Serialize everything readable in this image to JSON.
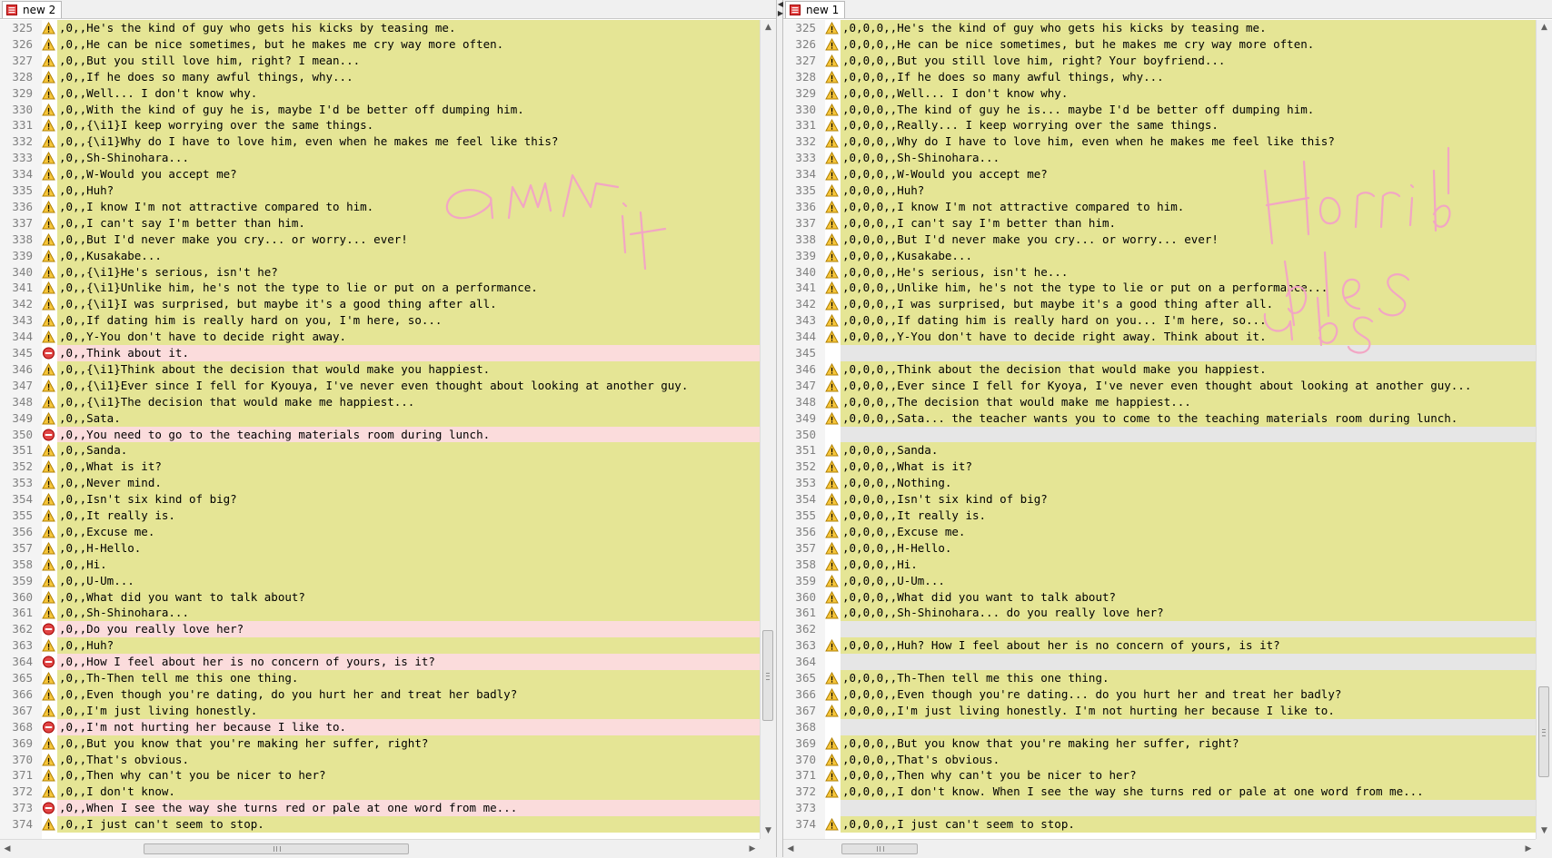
{
  "colors": {
    "warn_line_bg": "#e5e595",
    "deleted_line_bg": "#fbdcdc",
    "empty_line_bg": "#e6e6e6",
    "scribble_pink": "#f2a6c4"
  },
  "icons": {
    "warning": "warning-triangle-icon",
    "deleted": "removed-circle-icon",
    "tab": "notepad-file-icon"
  },
  "scribbles": {
    "left": "am it",
    "right": "Horri bles ubs"
  },
  "left": {
    "tab_label": "new 2",
    "lines": [
      {
        "n": "325",
        "t": ",0,,He's the kind of guy who gets his kicks by teasing me.",
        "s": "warn"
      },
      {
        "n": "326",
        "t": ",0,,He can be nice sometimes, but he makes me cry way more often.",
        "s": "warn"
      },
      {
        "n": "327",
        "t": ",0,,But you still love him, right? I mean...",
        "s": "warn"
      },
      {
        "n": "328",
        "t": ",0,,If he does so many awful things, why...",
        "s": "warn"
      },
      {
        "n": "329",
        "t": ",0,,Well... I don't know why.",
        "s": "warn"
      },
      {
        "n": "330",
        "t": ",0,,With the kind of guy he is, maybe I'd be better off dumping him.",
        "s": "warn"
      },
      {
        "n": "331",
        "t": ",0,,{\\i1}I keep worrying over the same things.",
        "s": "warn"
      },
      {
        "n": "332",
        "t": ",0,,{\\i1}Why do I have to love him, even when he makes me feel like this?",
        "s": "warn"
      },
      {
        "n": "333",
        "t": ",0,,Sh-Shinohara...",
        "s": "warn"
      },
      {
        "n": "334",
        "t": ",0,,W-Would you accept me?",
        "s": "warn"
      },
      {
        "n": "335",
        "t": ",0,,Huh?",
        "s": "warn"
      },
      {
        "n": "336",
        "t": ",0,,I know I'm not attractive compared to him.",
        "s": "warn"
      },
      {
        "n": "337",
        "t": ",0,,I can't say I'm better than him.",
        "s": "warn"
      },
      {
        "n": "338",
        "t": ",0,,But I'd never make you cry... or worry... ever!",
        "s": "warn"
      },
      {
        "n": "339",
        "t": ",0,,Kusakabe...",
        "s": "warn"
      },
      {
        "n": "340",
        "t": ",0,,{\\i1}He's serious, isn't he?",
        "s": "warn"
      },
      {
        "n": "341",
        "t": ",0,,{\\i1}Unlike him, he's not the type to lie or put on a performance.",
        "s": "warn"
      },
      {
        "n": "342",
        "t": ",0,,{\\i1}I was surprised, but maybe it's a good thing after all.",
        "s": "warn"
      },
      {
        "n": "343",
        "t": ",0,,If dating him is really hard on you, I'm here, so...",
        "s": "warn"
      },
      {
        "n": "344",
        "t": ",0,,Y-You don't have to decide right away.",
        "s": "warn"
      },
      {
        "n": "345",
        "t": ",0,,Think about it.",
        "s": "del"
      },
      {
        "n": "346",
        "t": ",0,,{\\i1}Think about the decision that would make you happiest.",
        "s": "warn"
      },
      {
        "n": "347",
        "t": ",0,,{\\i1}Ever since I fell for Kyouya, I've never even thought about looking at another guy.",
        "s": "warn"
      },
      {
        "n": "348",
        "t": ",0,,{\\i1}The decision that would make me happiest...",
        "s": "warn"
      },
      {
        "n": "349",
        "t": ",0,,Sata.",
        "s": "warn"
      },
      {
        "n": "350",
        "t": ",0,,You need to go to the teaching materials room during lunch.",
        "s": "del"
      },
      {
        "n": "351",
        "t": ",0,,Sanda.",
        "s": "warn"
      },
      {
        "n": "352",
        "t": ",0,,What is it?",
        "s": "warn"
      },
      {
        "n": "353",
        "t": ",0,,Never mind.",
        "s": "warn"
      },
      {
        "n": "354",
        "t": ",0,,Isn't six kind of big?",
        "s": "warn"
      },
      {
        "n": "355",
        "t": ",0,,It really is.",
        "s": "warn"
      },
      {
        "n": "356",
        "t": ",0,,Excuse me.",
        "s": "warn"
      },
      {
        "n": "357",
        "t": ",0,,H-Hello.",
        "s": "warn"
      },
      {
        "n": "358",
        "t": ",0,,Hi.",
        "s": "warn"
      },
      {
        "n": "359",
        "t": ",0,,U-Um...",
        "s": "warn"
      },
      {
        "n": "360",
        "t": ",0,,What did you want to talk about?",
        "s": "warn"
      },
      {
        "n": "361",
        "t": ",0,,Sh-Shinohara...",
        "s": "warn"
      },
      {
        "n": "362",
        "t": ",0,,Do you really love her?",
        "s": "del"
      },
      {
        "n": "363",
        "t": ",0,,Huh?",
        "s": "warn"
      },
      {
        "n": "364",
        "t": ",0,,How I feel about her is no concern of yours, is it?",
        "s": "del"
      },
      {
        "n": "365",
        "t": ",0,,Th-Then tell me this one thing.",
        "s": "warn"
      },
      {
        "n": "366",
        "t": ",0,,Even though you're dating, do you hurt her and treat her badly?",
        "s": "warn"
      },
      {
        "n": "367",
        "t": ",0,,I'm just living honestly.",
        "s": "warn"
      },
      {
        "n": "368",
        "t": ",0,,I'm not hurting her because I like to.",
        "s": "del"
      },
      {
        "n": "369",
        "t": ",0,,But you know that you're making her suffer, right?",
        "s": "warn"
      },
      {
        "n": "370",
        "t": ",0,,That's obvious.",
        "s": "warn"
      },
      {
        "n": "371",
        "t": ",0,,Then why can't you be nicer to her?",
        "s": "warn"
      },
      {
        "n": "372",
        "t": ",0,,I don't know.",
        "s": "warn"
      },
      {
        "n": "373",
        "t": ",0,,When I see the way she turns red or pale at one word from me...",
        "s": "del"
      },
      {
        "n": "374",
        "t": ",0,,I just can't seem to stop.",
        "s": "warn"
      }
    ]
  },
  "right": {
    "tab_label": "new 1",
    "lines": [
      {
        "n": "325",
        "t": ",0,0,0,,He's the kind of guy who gets his kicks by teasing me.",
        "s": "warn"
      },
      {
        "n": "326",
        "t": ",0,0,0,,He can be nice sometimes, but he makes me cry way more often.",
        "s": "warn"
      },
      {
        "n": "327",
        "t": ",0,0,0,,But you still love him, right? Your boyfriend...",
        "s": "warn"
      },
      {
        "n": "328",
        "t": ",0,0,0,,If he does so many awful things, why...",
        "s": "warn"
      },
      {
        "n": "329",
        "t": ",0,0,0,,Well... I don't know why.",
        "s": "warn"
      },
      {
        "n": "330",
        "t": ",0,0,0,,The kind of guy he is... maybe I'd be better off dumping him.",
        "s": "warn"
      },
      {
        "n": "331",
        "t": ",0,0,0,,Really... I keep worrying over the same things.",
        "s": "warn"
      },
      {
        "n": "332",
        "t": ",0,0,0,,Why do I have to love him, even when he makes me feel like this?",
        "s": "warn"
      },
      {
        "n": "333",
        "t": ",0,0,0,,Sh-Shinohara...",
        "s": "warn"
      },
      {
        "n": "334",
        "t": ",0,0,0,,W-Would you accept me?",
        "s": "warn"
      },
      {
        "n": "335",
        "t": ",0,0,0,,Huh?",
        "s": "warn"
      },
      {
        "n": "336",
        "t": ",0,0,0,,I know I'm not attractive compared to him.",
        "s": "warn"
      },
      {
        "n": "337",
        "t": ",0,0,0,,I can't say I'm better than him.",
        "s": "warn"
      },
      {
        "n": "338",
        "t": ",0,0,0,,But I'd never make you cry... or worry... ever!",
        "s": "warn"
      },
      {
        "n": "339",
        "t": ",0,0,0,,Kusakabe...",
        "s": "warn"
      },
      {
        "n": "340",
        "t": ",0,0,0,,He's serious, isn't he...",
        "s": "warn"
      },
      {
        "n": "341",
        "t": ",0,0,0,,Unlike him, he's not the type to lie or put on a performance...",
        "s": "warn"
      },
      {
        "n": "342",
        "t": ",0,0,0,,I was surprised, but maybe it's a good thing after all.",
        "s": "warn"
      },
      {
        "n": "343",
        "t": ",0,0,0,,If dating him is really hard on you... I'm here, so...",
        "s": "warn"
      },
      {
        "n": "344",
        "t": ",0,0,0,,Y-You don't have to decide right away. Think about it.",
        "s": "warn"
      },
      {
        "n": "345",
        "t": "",
        "s": "empty"
      },
      {
        "n": "346",
        "t": ",0,0,0,,Think about the decision that would make you happiest.",
        "s": "warn"
      },
      {
        "n": "347",
        "t": ",0,0,0,,Ever since I fell for Kyoya, I've never even thought about looking at another guy...",
        "s": "warn"
      },
      {
        "n": "348",
        "t": ",0,0,0,,The decision that would make me happiest...",
        "s": "warn"
      },
      {
        "n": "349",
        "t": ",0,0,0,,Sata... the teacher wants you to come to the teaching materials room during lunch.",
        "s": "warn"
      },
      {
        "n": "350",
        "t": "",
        "s": "empty"
      },
      {
        "n": "351",
        "t": ",0,0,0,,Sanda.",
        "s": "warn"
      },
      {
        "n": "352",
        "t": ",0,0,0,,What is it?",
        "s": "warn"
      },
      {
        "n": "353",
        "t": ",0,0,0,,Nothing.",
        "s": "warn"
      },
      {
        "n": "354",
        "t": ",0,0,0,,Isn't six kind of big?",
        "s": "warn"
      },
      {
        "n": "355",
        "t": ",0,0,0,,It really is.",
        "s": "warn"
      },
      {
        "n": "356",
        "t": ",0,0,0,,Excuse me.",
        "s": "warn"
      },
      {
        "n": "357",
        "t": ",0,0,0,,H-Hello.",
        "s": "warn"
      },
      {
        "n": "358",
        "t": ",0,0,0,,Hi.",
        "s": "warn"
      },
      {
        "n": "359",
        "t": ",0,0,0,,U-Um...",
        "s": "warn"
      },
      {
        "n": "360",
        "t": ",0,0,0,,What did you want to talk about?",
        "s": "warn"
      },
      {
        "n": "361",
        "t": ",0,0,0,,Sh-Shinohara... do you really love her?",
        "s": "warn"
      },
      {
        "n": "362",
        "t": "",
        "s": "empty"
      },
      {
        "n": "363",
        "t": ",0,0,0,,Huh? How I feel about her is no concern of yours, is it?",
        "s": "warn"
      },
      {
        "n": "364",
        "t": "",
        "s": "empty"
      },
      {
        "n": "365",
        "t": ",0,0,0,,Th-Then tell me this one thing.",
        "s": "warn"
      },
      {
        "n": "366",
        "t": ",0,0,0,,Even though you're dating... do you hurt her and treat her badly?",
        "s": "warn"
      },
      {
        "n": "367",
        "t": ",0,0,0,,I'm just living honestly. I'm not hurting her because I like to.",
        "s": "warn"
      },
      {
        "n": "368",
        "t": "",
        "s": "empty"
      },
      {
        "n": "369",
        "t": ",0,0,0,,But you know that you're making her suffer, right?",
        "s": "warn"
      },
      {
        "n": "370",
        "t": ",0,0,0,,That's obvious.",
        "s": "warn"
      },
      {
        "n": "371",
        "t": ",0,0,0,,Then why can't you be nicer to her?",
        "s": "warn"
      },
      {
        "n": "372",
        "t": ",0,0,0,,I don't know. When I see the way she turns red or pale at one word from me...",
        "s": "warn"
      },
      {
        "n": "373",
        "t": "",
        "s": "empty"
      },
      {
        "n": "374",
        "t": ",0,0,0,,I just can't seem to stop.",
        "s": "warn"
      }
    ]
  }
}
